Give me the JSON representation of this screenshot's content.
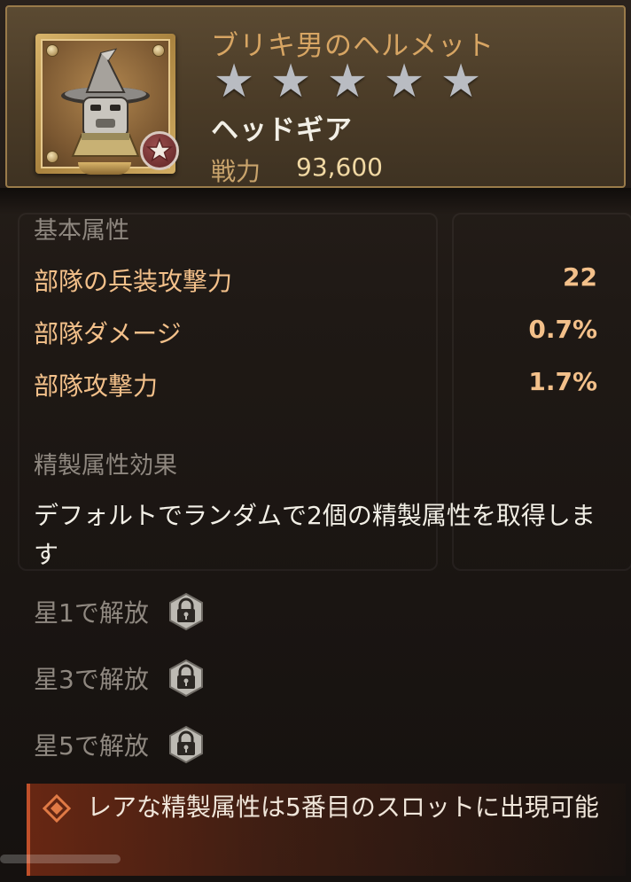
{
  "item": {
    "name": "ブリキ男のヘルメット",
    "stars": [
      "★",
      "★",
      "★",
      "★",
      "★"
    ],
    "slot_type": "ヘッドギア",
    "power_label": "戦力",
    "power_value": "93,600",
    "icon": "tin-man-helmet-icon",
    "badge_icon": "star-badge-icon"
  },
  "base_attributes": {
    "label": "基本属性",
    "stats": [
      {
        "name": "部隊の兵装攻撃力",
        "value": "22"
      },
      {
        "name": "部隊ダメージ",
        "value": "0.7%"
      },
      {
        "name": "部隊攻撃力",
        "value": "1.7%"
      }
    ]
  },
  "refine": {
    "label": "精製属性効果",
    "description": "デフォルトでランダムで2個の精製属性を取得します",
    "locks": [
      {
        "label": "星1で解放",
        "icon": "padlock-icon"
      },
      {
        "label": "星3で解放",
        "icon": "padlock-icon"
      },
      {
        "label": "星5で解放",
        "icon": "padlock-icon"
      }
    ]
  },
  "notice": {
    "text": "レアな精製属性は5番目のスロットに出現可能",
    "icon": "diamond-bullet-icon",
    "accent": "#c0502a"
  },
  "colors": {
    "title": "#d7a563",
    "stat": "#f3c08a",
    "muted": "#8f8880",
    "star": "#b9bcc2"
  }
}
